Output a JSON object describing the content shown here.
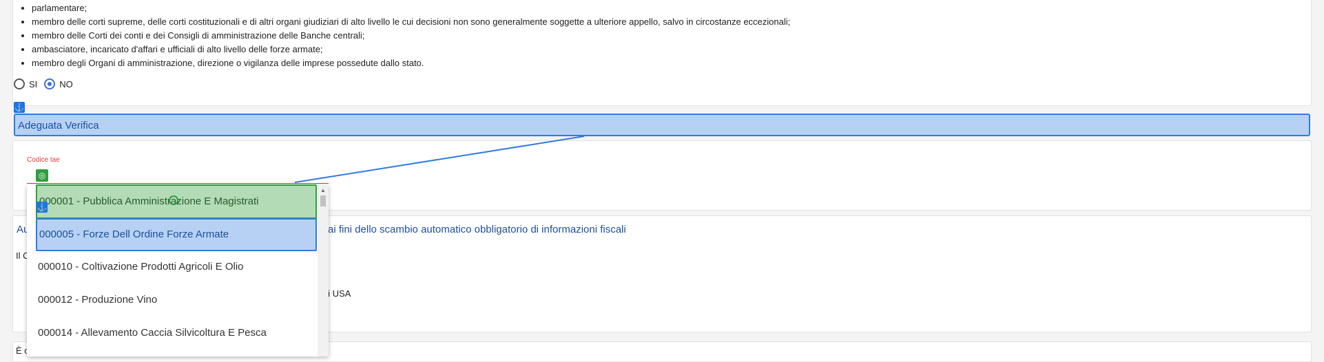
{
  "pep_list": [
    "parlamentare;",
    "membro delle corti supreme, delle corti costituzionali e di altri organi giudiziari di alto livello le cui decisioni non sono generalmente soggette a ulteriore appello, salvo in circostanze eccezionali;",
    "membro delle Corti dei conti e dei Consigli di amministrazione delle Banche centrali;",
    "ambasciatore, incaricato d'affari e ufficiali di alto livello delle forze armate;",
    "membro degli Organi di amministrazione, direzione o vigilanza delle imprese possedute dallo stato."
  ],
  "radio": {
    "yes_label": "SI",
    "no_label": "NO",
    "selected": "NO"
  },
  "section": {
    "title": "Adeguata Verifica"
  },
  "codice_tae": {
    "label": "Codice tae"
  },
  "dropdown_options": [
    "000001 - Pubblica Amministrazione E Magistrati",
    "000005 - Forze Dell Ordine Forze Armate",
    "000010 - Coltivazione Prodotti Agricoli E Olio",
    "000012 - Produzione Vino",
    "000014 - Allevamento Caccia Silvicoltura E Pesca"
  ],
  "crs": {
    "title_start": "Au",
    "title_tail": "ai fini dello scambio automatico obbligatorio di informazioni fiscali",
    "para_start": "Il C",
    "usa_fragment": "gli USA"
  },
  "bottom": {
    "text": "È c"
  },
  "icons": {
    "anchor": "anchor-icon",
    "target": "target-icon"
  },
  "colors": {
    "accent_blue": "#2f7ae5",
    "highlight_blue": "#b7d1f4",
    "highlight_green": "#b3dcb6",
    "error_red": "#e53935"
  }
}
